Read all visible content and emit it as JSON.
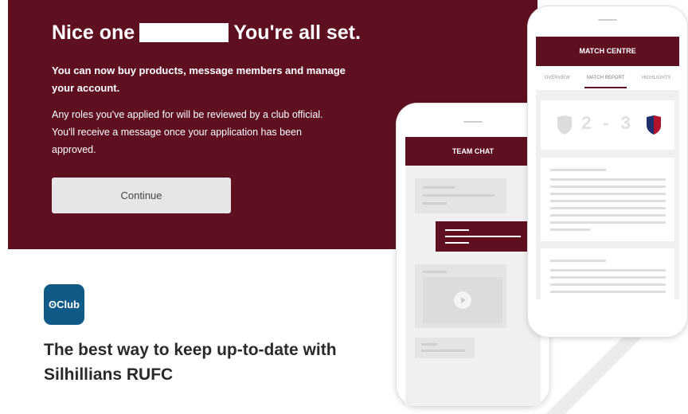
{
  "banner": {
    "headline_start": "Nice one",
    "headline_end": "You're all set.",
    "intro": "You can now buy products, message members and manage your account.",
    "roles_note": "Any roles you've applied for will be reviewed by a club official. You'll receive a message once your application has been approved.",
    "continue_label": "Continue"
  },
  "promo": {
    "logo_text": "ʘClub",
    "tagline": "The best way to keep up-to-date with Silhillians RUFC"
  },
  "phone_left": {
    "title": "TEAM CHAT"
  },
  "phone_right": {
    "title": "MATCH CENTRE",
    "tabs": [
      "OVERVIEW",
      "MATCH REPORT",
      "HIGHLIGHTS"
    ],
    "score": "2 - 3"
  },
  "colors": {
    "brand": "#5e1020",
    "logo_bg": "#0f5a86"
  }
}
